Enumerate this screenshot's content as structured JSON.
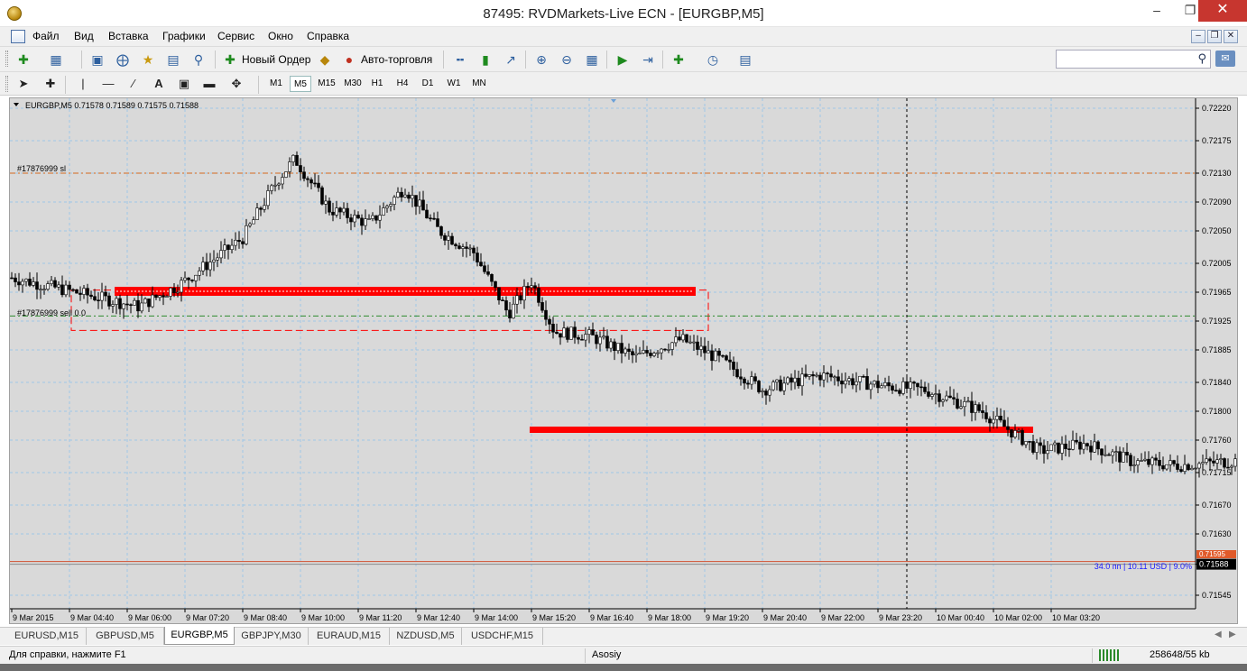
{
  "window": {
    "title": "87495: RVDMarkets-Live ECN - [EURGBP,M5]"
  },
  "menu": [
    "Файл",
    "Вид",
    "Вставка",
    "Графики",
    "Сервис",
    "Окно",
    "Справка"
  ],
  "toolbar": {
    "new_order": "Новый Ордер",
    "autotrading": "Авто-торговля"
  },
  "timeframes": [
    "M1",
    "M5",
    "M15",
    "M30",
    "H1",
    "H4",
    "D1",
    "W1",
    "MN"
  ],
  "active_timeframe": "M5",
  "chart_header": "EURGBP,M5  0.71578 0.71589 0.71575 0.71588",
  "chart_labels": {
    "sl_line": "#17876999 sl",
    "sell_line": "#17876999 sell 0.0",
    "profit": "34.0 пп | 10.11 USD | 9.0%",
    "current_price": "0.71588",
    "ask_price": "0.71595"
  },
  "colors": {
    "chart_bg": "#d9d9d9",
    "grid": "#9fc6e6",
    "candles": "#000000",
    "zone": "#ff0000",
    "sl_line": "#d2691e",
    "sell_line": "#2e8b2e",
    "profit_text": "#1a1aff"
  },
  "chart_data": {
    "type": "candlestick",
    "symbol": "EURGBP",
    "timeframe": "M5",
    "price_axis": [
      "0.72220",
      "0.72175",
      "0.72130",
      "0.72090",
      "0.72050",
      "0.72005",
      "0.71965",
      "0.71925",
      "0.71885",
      "0.71840",
      "0.71800",
      "0.71760",
      "0.71715",
      "0.71670",
      "0.71630",
      "0.71588",
      "0.71545"
    ],
    "time_axis": [
      "9 Mar 2015",
      "9 Mar 04:40",
      "9 Mar 06:00",
      "9 Mar 07:20",
      "9 Mar 08:40",
      "9 Mar 10:00",
      "9 Mar 11:20",
      "9 Mar 12:40",
      "9 Mar 14:00",
      "9 Mar 15:20",
      "9 Mar 16:40",
      "9 Mar 18:00",
      "9 Mar 19:20",
      "9 Mar 20:40",
      "9 Mar 22:00",
      "9 Mar 23:20",
      "10 Mar 00:40",
      "10 Mar 02:00",
      "10 Mar 03:20"
    ],
    "ylim": [
      0.7153,
      0.7223
    ],
    "sl_price": 0.7213,
    "sell_price": 0.71932,
    "current_price": 0.71588,
    "ask_price": 0.71595,
    "zones": [
      {
        "from": "9 Mar 04:40",
        "to": "9 Mar 19:20",
        "price": 0.71965,
        "low": 0.71912,
        "high": 0.71968
      },
      {
        "from": "9 Mar 15:20",
        "to": "10 Mar 03:20",
        "price": 0.71775
      }
    ],
    "path": [
      [
        0,
        0.71985
      ],
      [
        2.2,
        0.71945
      ],
      [
        2.9,
        0.71975
      ],
      [
        4.0,
        0.7204
      ],
      [
        4.6,
        0.7212
      ],
      [
        4.9,
        0.7215
      ],
      [
        5.5,
        0.7208
      ],
      [
        6.2,
        0.7206
      ],
      [
        6.8,
        0.7211
      ],
      [
        7.4,
        0.7205
      ],
      [
        8.0,
        0.7202
      ],
      [
        8.6,
        0.71935
      ],
      [
        9.0,
        0.7198
      ],
      [
        9.4,
        0.7191
      ],
      [
        10.0,
        0.71905
      ],
      [
        10.8,
        0.71875
      ],
      [
        11.6,
        0.719
      ],
      [
        12.3,
        0.7187
      ],
      [
        13.0,
        0.7183
      ],
      [
        14.0,
        0.7185
      ],
      [
        15.1,
        0.71835
      ],
      [
        15.8,
        0.7183
      ],
      [
        16.8,
        0.718
      ],
      [
        17.8,
        0.71745
      ],
      [
        18.6,
        0.71755
      ],
      [
        19.4,
        0.7173
      ],
      [
        20.2,
        0.71725
      ],
      [
        21.8,
        0.71735
      ],
      [
        22.6,
        0.7177
      ],
      [
        23.3,
        0.71765
      ],
      [
        23.8,
        0.71735
      ],
      [
        24.6,
        0.7172
      ],
      [
        25.4,
        0.71745
      ],
      [
        26.3,
        0.71735
      ],
      [
        27.1,
        0.7176
      ],
      [
        27.6,
        0.7175
      ],
      [
        28.0,
        0.717
      ],
      [
        28.3,
        0.7164
      ],
      [
        28.6,
        0.71575
      ],
      [
        28.8,
        0.71588
      ]
    ]
  },
  "tabs": [
    "EURUSD,M15",
    "GBPUSD,M5",
    "EURGBP,M5",
    "GBPJPY,M30",
    "EURAUD,M15",
    "NZDUSD,M5",
    "USDCHF,M15"
  ],
  "active_tab": "EURGBP,M5",
  "status": {
    "help": "Для справки, нажмите F1",
    "profile": "Asosiy",
    "traffic": "258648/55 kb"
  }
}
